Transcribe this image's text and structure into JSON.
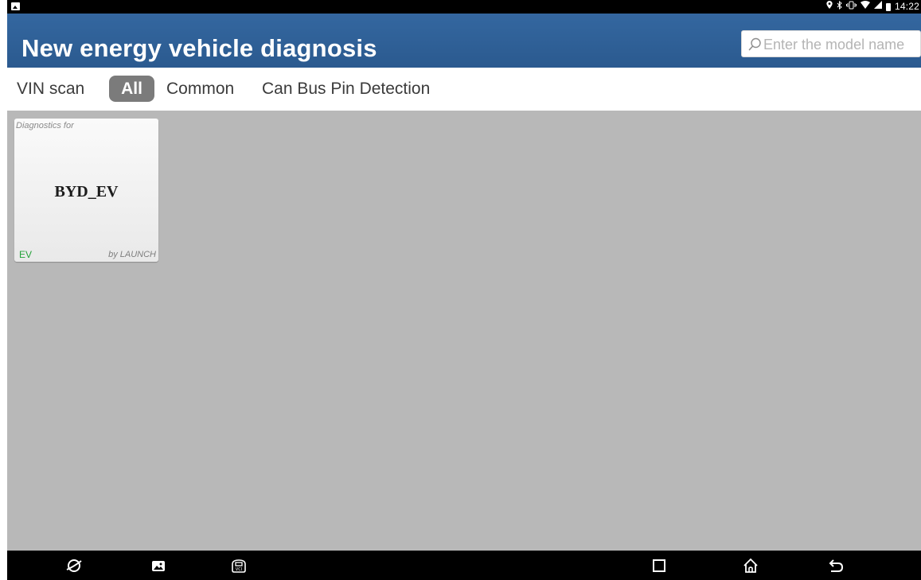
{
  "status_bar": {
    "icons": [
      "image-icon",
      "location-icon",
      "bluetooth-icon",
      "vibrate-icon",
      "wifi-icon",
      "signal-icon",
      "battery-icon"
    ],
    "time": "14:22"
  },
  "header": {
    "title": "New energy vehicle diagnosis",
    "search": {
      "placeholder": "Enter the model name",
      "value": ""
    }
  },
  "tabs": [
    {
      "label": "VIN scan",
      "selected": false
    },
    {
      "label": "All",
      "selected": true
    },
    {
      "label": "Common",
      "selected": false
    },
    {
      "label": "Can Bus Pin Detection",
      "selected": false
    }
  ],
  "cards": [
    {
      "prefix": "Diagnostics for",
      "title": "BYD_EV",
      "badge": "EV",
      "vendor": "by LAUNCH"
    }
  ],
  "nav_bar": {
    "icons": [
      "browser-icon",
      "gallery-icon",
      "vci-icon",
      "recents-icon",
      "home-icon",
      "back-icon"
    ]
  },
  "colors": {
    "header_bg": "#2f5f96",
    "tab_selected_bg": "#7b7b7b",
    "content_bg": "#b8b8b8",
    "badge_green": "#24a23a"
  }
}
